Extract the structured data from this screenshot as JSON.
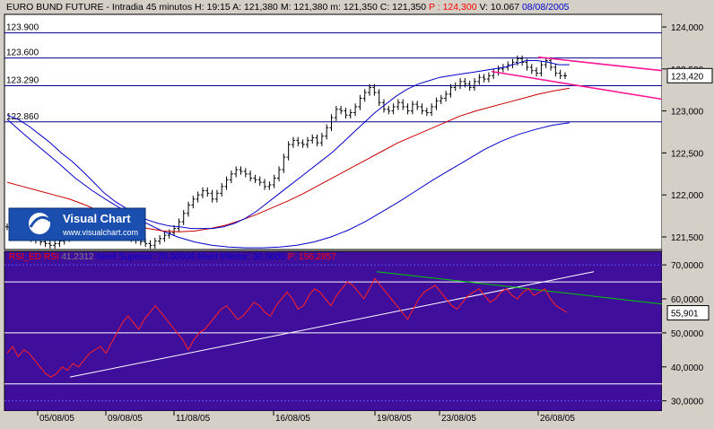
{
  "header": {
    "parts": [
      {
        "text": "EURO BUND FUTURE - Intradia 45 minutos",
        "color": "#000000"
      },
      {
        "text": "H: 19:15",
        "color": "#000000"
      },
      {
        "text": "A: 121,380",
        "color": "#000000"
      },
      {
        "text": "M: 121,380",
        "color": "#000000"
      },
      {
        "text": "m: 121,350",
        "color": "#000000"
      },
      {
        "text": "C: 121,350",
        "color": "#000000"
      },
      {
        "text": "P : 124,300",
        "color": "#ff0000"
      },
      {
        "text": "V: 10.067",
        "color": "#000000"
      },
      {
        "text": "08/08/2005",
        "color": "#0000cc"
      }
    ]
  },
  "logo": {
    "name": "Visual Chart",
    "url": "www.visualchart.com"
  },
  "rsi_header": {
    "parts": [
      {
        "text": "RSI_ED  RSI",
        "color": "#ff0000"
      },
      {
        "text": "41,2312",
        "color": "#808080"
      },
      {
        "text": "Nivel Superior: 70,00000",
        "color": "#0000cc"
      },
      {
        "text": "Nivel Inferior: 30,0000",
        "color": "#0000cc"
      },
      {
        "text": "P: 156,2857",
        "color": "#ff0000"
      }
    ]
  },
  "colors": {
    "price_bg": "#ffffff",
    "rsi_bg": "#3f0f9c",
    "price_bar": "#000000",
    "mov_avg_1": "#0000cc",
    "mov_avg_2": "#cc0000",
    "mov_avg_3": "#0000cc",
    "channel": "#ff1493",
    "h_levels": "#000088",
    "rsi_line": "#ff2020",
    "rsi_trend_up": "#ffffff",
    "rsi_trend_down": "#00cc00"
  },
  "chart_data": [
    {
      "type": "line",
      "name": "price",
      "x_labels": [
        "05/08/05",
        "09/08/05",
        "11/08/05",
        "16/08/05",
        "19/08/05",
        "23/08/05",
        "26/08/05"
      ],
      "y_ticks": [
        "124,000",
        "123,500",
        "123,000",
        "122,500",
        "122,000",
        "121,500"
      ],
      "ylim": [
        121.35,
        124.15
      ],
      "horizontal_levels": [
        {
          "label": "123.900",
          "value": 123.93
        },
        {
          "label": "123.600",
          "value": 123.63
        },
        {
          "label": "123.290",
          "value": 123.3
        },
        {
          "label": "122.860",
          "value": 122.87
        }
      ],
      "last_price_label": "123,420",
      "last_price": 123.42,
      "close_series": [
        121.62,
        121.6,
        121.58,
        121.55,
        121.52,
        121.48,
        121.46,
        121.44,
        121.42,
        121.4,
        121.42,
        121.45,
        121.48,
        121.5,
        121.52,
        121.55,
        121.58,
        121.6,
        121.63,
        121.65,
        121.62,
        121.6,
        121.58,
        121.55,
        121.52,
        121.5,
        121.48,
        121.46,
        121.44,
        121.42,
        121.4,
        121.45,
        121.48,
        121.52,
        121.55,
        121.6,
        121.68,
        121.78,
        121.88,
        121.95,
        122.0,
        122.05,
        122.02,
        121.95,
        122.02,
        122.1,
        122.18,
        122.25,
        122.3,
        122.28,
        122.25,
        122.2,
        122.18,
        122.15,
        122.1,
        122.12,
        122.2,
        122.3,
        122.45,
        122.6,
        122.65,
        122.62,
        122.6,
        122.65,
        122.68,
        122.62,
        122.7,
        122.8,
        122.92,
        123.02,
        123.0,
        122.95,
        122.98,
        123.05,
        123.15,
        123.22,
        123.28,
        123.22,
        123.1,
        123.02,
        123.0,
        123.05,
        123.1,
        123.05,
        123.0,
        123.08,
        123.05,
        123.0,
        122.98,
        123.05,
        123.12,
        123.15,
        123.2,
        123.28,
        123.3,
        123.35,
        123.32,
        123.28,
        123.35,
        123.4,
        123.38,
        123.42,
        123.46,
        123.5,
        123.52,
        123.55,
        123.58,
        123.62,
        123.58,
        123.52,
        123.48,
        123.45,
        123.55,
        123.6,
        123.52,
        123.45,
        123.42,
        123.42
      ],
      "mov_avg_fast": [
        122.95,
        122.9,
        122.82,
        122.72,
        122.62,
        122.5,
        122.4,
        122.28,
        122.15,
        122.02,
        121.92,
        121.84,
        121.76,
        121.7,
        121.66,
        121.63,
        121.62,
        121.6,
        121.6,
        121.6,
        121.62,
        121.66,
        121.72,
        121.8,
        121.9,
        122.0,
        122.1,
        122.2,
        122.3,
        122.4,
        122.5,
        122.62,
        122.74,
        122.86,
        122.98,
        123.08,
        123.18,
        123.26,
        123.32,
        123.36,
        123.4,
        123.42,
        123.44,
        123.46,
        123.48,
        123.5,
        123.52,
        123.56,
        123.6,
        123.6,
        123.58,
        123.55,
        123.55
      ],
      "mov_avg_mid": [
        122.15,
        122.1,
        122.05,
        122.0,
        121.95,
        121.88,
        121.8,
        121.72,
        121.65,
        121.6,
        121.57,
        121.56,
        121.57,
        121.6,
        121.64,
        121.7,
        121.77,
        121.85,
        121.93,
        122.02,
        122.12,
        122.22,
        122.32,
        122.42,
        122.52,
        122.62,
        122.7,
        122.78,
        122.86,
        122.94,
        123.0,
        123.05,
        123.1,
        123.15,
        123.2,
        123.24,
        123.27
      ],
      "mov_avg_slow": [
        122.9,
        122.72,
        122.55,
        122.38,
        122.2,
        122.05,
        121.92,
        121.8,
        121.68,
        121.58,
        121.5,
        121.44,
        121.4,
        121.38,
        121.37,
        121.37,
        121.38,
        121.4,
        121.44,
        121.5,
        121.58,
        121.68,
        121.8,
        121.92,
        122.05,
        122.18,
        122.3,
        122.42,
        122.54,
        122.64,
        122.72,
        122.78,
        122.83,
        122.86
      ]
    },
    {
      "type": "line",
      "name": "RSI",
      "y_ticks": [
        "70,0000",
        "60,0000",
        "55,901",
        "50,0000",
        "40,0000",
        "30,0000"
      ],
      "ylim": [
        27,
        74
      ],
      "levels": [
        70,
        65,
        50,
        35,
        30
      ],
      "last_value_label": "55,901",
      "last_value": 55.9,
      "values": [
        44,
        46,
        43,
        45,
        44,
        42,
        40,
        38,
        37,
        38,
        40,
        39,
        41,
        40,
        42,
        44,
        45,
        46,
        44,
        47,
        50,
        53,
        55,
        53,
        51,
        54,
        56,
        58,
        56,
        54,
        52,
        50,
        48,
        45,
        48,
        50,
        51,
        53,
        55,
        57,
        58,
        56,
        54,
        55,
        57,
        59,
        58,
        56,
        55,
        58,
        60,
        62,
        60,
        57,
        58,
        61,
        63,
        62,
        60,
        58,
        61,
        63,
        65,
        64,
        62,
        60,
        63,
        66,
        64,
        62,
        60,
        58,
        56,
        54,
        57,
        60,
        62,
        63,
        64,
        62,
        60,
        58,
        57,
        59,
        61,
        62,
        63,
        61,
        59,
        60,
        62,
        63,
        61,
        60,
        62,
        63,
        61,
        62,
        63,
        60,
        58,
        57,
        56
      ]
    }
  ]
}
